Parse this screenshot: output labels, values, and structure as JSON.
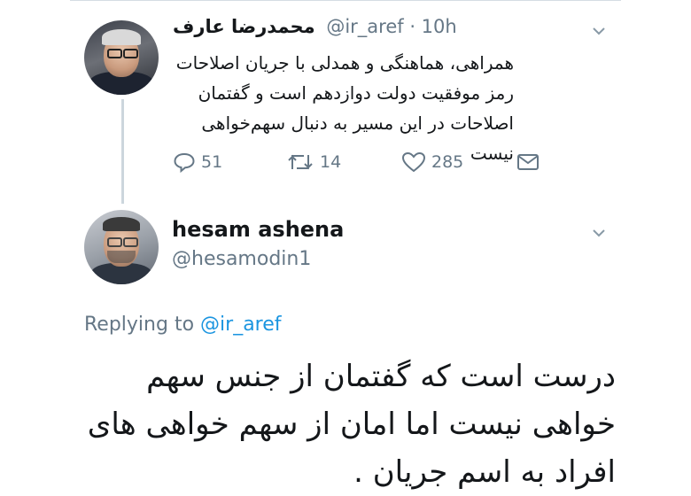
{
  "tweet1": {
    "display_name": "محمدرضا عارف",
    "handle_time": "@ir_aref · 10h",
    "text": "همراهی، هماهنگی و همدلی با جریان اصلاحات رمز موفقیت دولت دوازدهم است و گفتمان اصلاحات در این مسیر به دنبال سهم‌خواهی نیست",
    "reply_count": "51",
    "retweet_count": "14",
    "like_count": "285",
    "icons": [
      "reply-icon",
      "retweet-icon",
      "like-icon",
      "message-icon",
      "chevron-down-icon"
    ]
  },
  "tweet2": {
    "display_name": "hesam ashena",
    "handle": "@hesamodin1",
    "replying_prefix": "Replying to",
    "replying_handle": "@ir_aref",
    "text": "درست است که گفتمان از جنس سهم خواهی نیست اما امان از سهم خواهی های افراد به اسم جریان ."
  },
  "colors": {
    "text": "#14171a",
    "secondary": "#657786",
    "link": "#1b95e0",
    "thread_line": "#ccd6dd"
  }
}
